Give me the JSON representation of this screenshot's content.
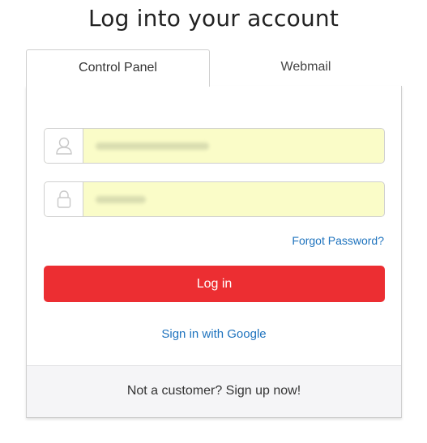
{
  "page": {
    "title": "Log into your account"
  },
  "tabs": [
    {
      "label": "Control Panel",
      "active": true
    },
    {
      "label": "Webmail",
      "active": false
    }
  ],
  "form": {
    "username": {
      "icon": "user-icon",
      "value": ""
    },
    "password": {
      "icon": "lock-icon",
      "value": ""
    },
    "forgot_label": "Forgot Password?",
    "login_label": "Log in",
    "google_label": "Sign in with Google"
  },
  "footer": {
    "signup_label": "Not a customer? Sign up now!"
  },
  "colors": {
    "accent_red": "#ec2e32",
    "link_blue": "#1e73be",
    "autofill_yellow": "#fafcc8",
    "border": "#cfcfcf"
  }
}
